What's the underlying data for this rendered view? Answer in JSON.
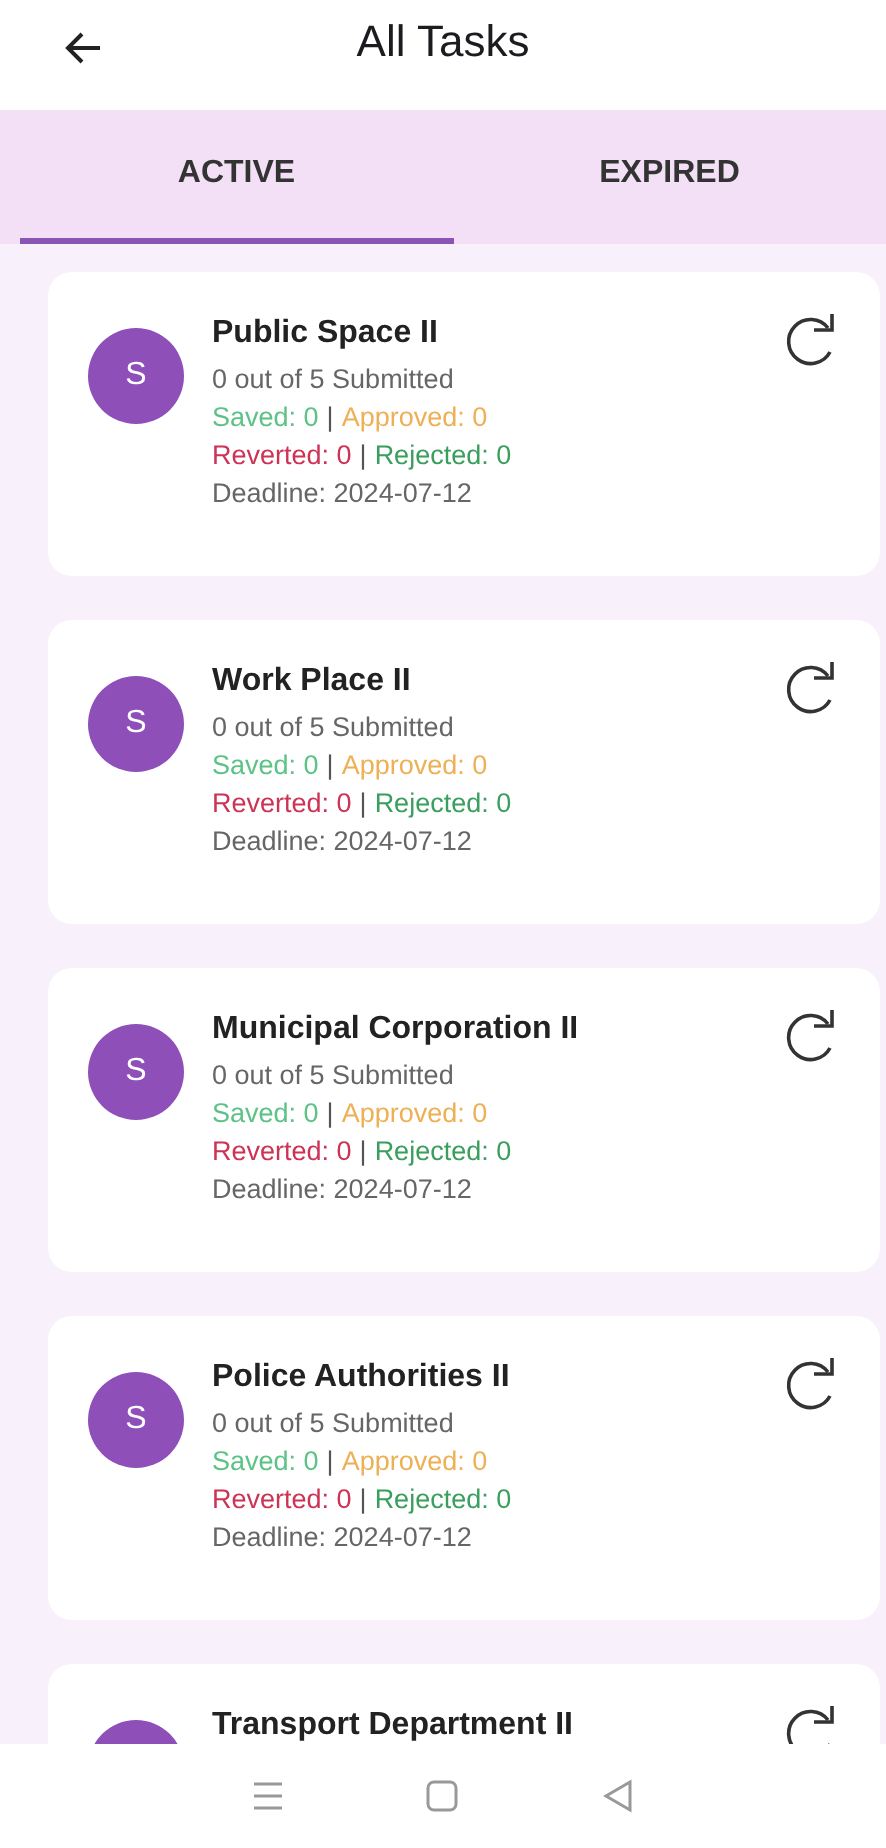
{
  "header": {
    "title": "All Tasks"
  },
  "tabs": [
    {
      "label": "ACTIVE",
      "selected": true
    },
    {
      "label": "EXPIRED",
      "selected": false
    }
  ],
  "tasks": [
    {
      "avatar": "S",
      "title": "Public Space II",
      "submitted": "0 out of 5 Submitted",
      "saved": "Saved: 0",
      "approved": "Approved: 0",
      "reverted": "Reverted: 0",
      "rejected": "Rejected: 0",
      "deadline": "Deadline: 2024-07-12"
    },
    {
      "avatar": "S",
      "title": "Work Place II",
      "submitted": "0 out of 5 Submitted",
      "saved": "Saved: 0",
      "approved": "Approved: 0",
      "reverted": "Reverted: 0",
      "rejected": "Rejected: 0",
      "deadline": "Deadline: 2024-07-12"
    },
    {
      "avatar": "S",
      "title": "Municipal Corporation II",
      "submitted": "0 out of 5 Submitted",
      "saved": "Saved: 0",
      "approved": "Approved: 0",
      "reverted": "Reverted: 0",
      "rejected": "Rejected: 0",
      "deadline": "Deadline: 2024-07-12"
    },
    {
      "avatar": "S",
      "title": "Police Authorities II",
      "submitted": "0 out of 5 Submitted",
      "saved": "Saved: 0",
      "approved": "Approved: 0",
      "reverted": "Reverted: 0",
      "rejected": "Rejected: 0",
      "deadline": "Deadline: 2024-07-12"
    },
    {
      "title": "Transport Department II"
    }
  ],
  "separator": "|"
}
